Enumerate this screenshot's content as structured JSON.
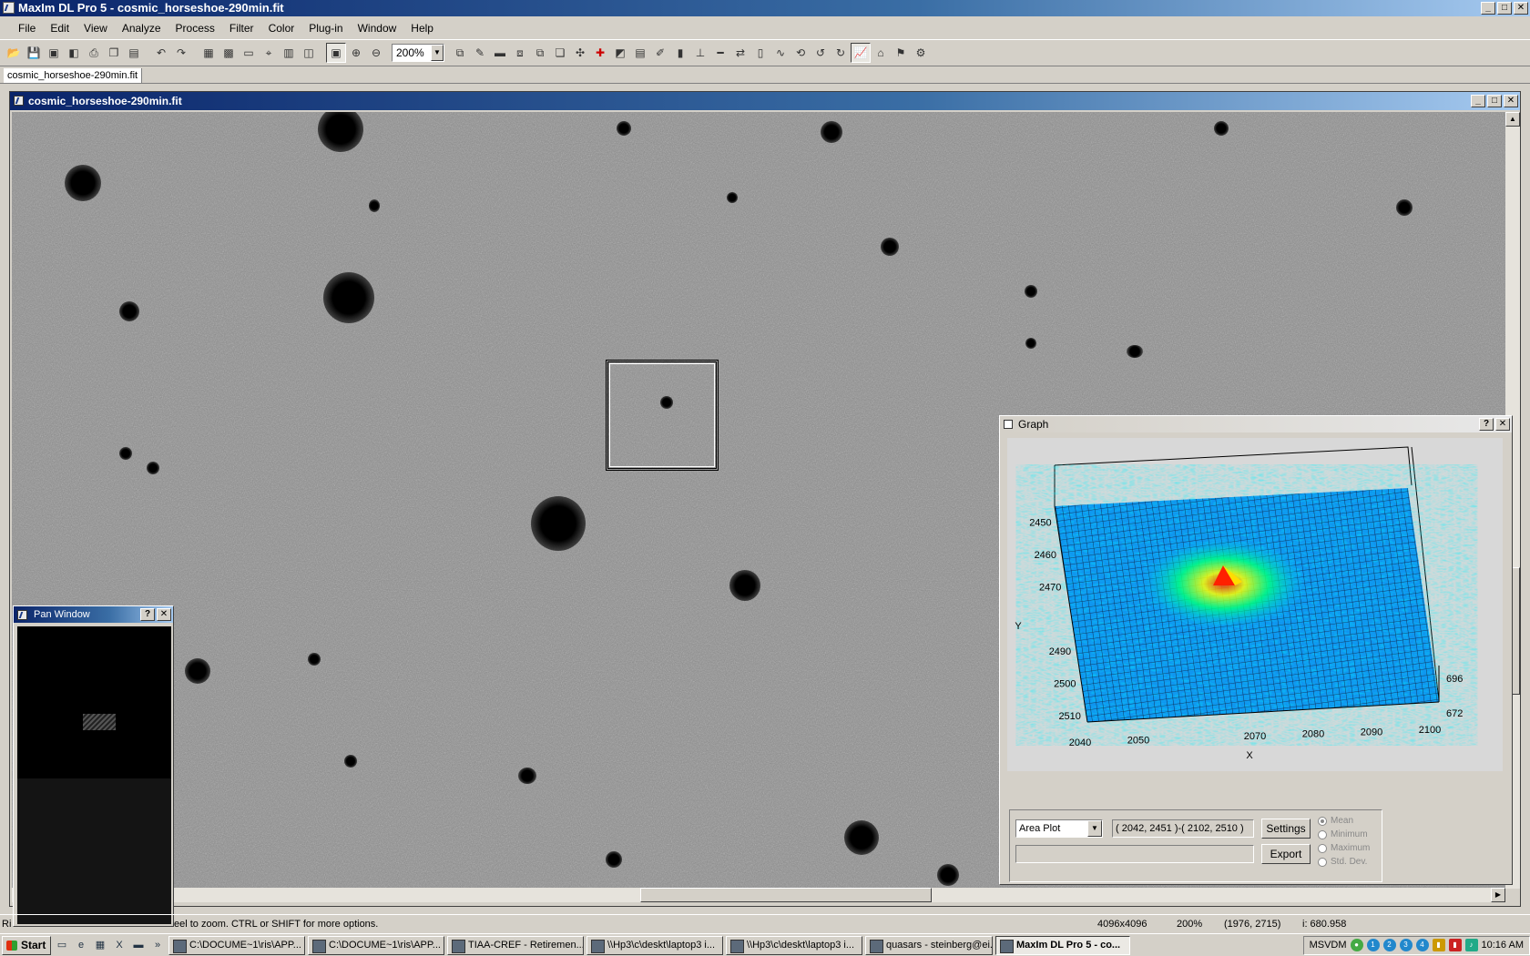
{
  "app": {
    "title": "MaxIm DL Pro 5 - cosmic_horseshoe-290min.fit",
    "window_buttons": {
      "min": "_",
      "max": "□",
      "close": "✕"
    }
  },
  "menu": [
    "File",
    "Edit",
    "View",
    "Analyze",
    "Process",
    "Filter",
    "Color",
    "Plug-in",
    "Window",
    "Help"
  ],
  "toolbar": {
    "zoom": "200%"
  },
  "doc_tab": "cosmic_horseshoe-290min.fit",
  "image_window": {
    "title": "cosmic_horseshoe-290min.fit"
  },
  "pan_window": {
    "title": "Pan Window",
    "help": "?",
    "close": "✕"
  },
  "graph": {
    "title": "Graph",
    "help": "?",
    "close": "✕",
    "plot_type": "Area Plot",
    "range": "( 2042, 2451 )-( 2102, 2510 )",
    "settings_label": "Settings",
    "export_label": "Export",
    "stat_options": [
      {
        "label": "Mean",
        "selected": true
      },
      {
        "label": "Minimum",
        "selected": false
      },
      {
        "label": "Maximum",
        "selected": false
      },
      {
        "label": "Std. Dev.",
        "selected": false
      }
    ]
  },
  "chart_data": {
    "type": "heatmap",
    "title": "",
    "xlabel": "X",
    "ylabel": "Y",
    "x_ticks": [
      2040,
      2050,
      2070,
      2080,
      2090,
      2100
    ],
    "y_ticks": [
      2450,
      2460,
      2470,
      2490,
      2500,
      2510
    ],
    "z_ticks": [
      696,
      672
    ],
    "peak": {
      "x": 2070,
      "y": 2462
    },
    "colormap": [
      "#1030c0",
      "#00c0ff",
      "#00ff80",
      "#ffff00",
      "#ff2000"
    ]
  },
  "status": {
    "hint": "Ri",
    "hint2": "eel to zoom. CTRL or SHIFT for more options.",
    "dims": "4096x4096",
    "zoom": "200%",
    "coords": "(1976, 2715)",
    "intensity": "i:  680.958"
  },
  "taskbar": {
    "start": "Start",
    "tasks": [
      {
        "label": "C:\\DOCUME~1\\ris\\APP...",
        "active": false
      },
      {
        "label": "C:\\DOCUME~1\\ris\\APP...",
        "active": false
      },
      {
        "label": "TIAA-CREF - Retiremen...",
        "active": false
      },
      {
        "label": "\\\\Hp3\\c\\deskt\\laptop3 i...",
        "active": false
      },
      {
        "label": "\\\\Hp3\\c\\deskt\\laptop3 i...",
        "active": false
      },
      {
        "label": "quasars - steinberg@ei...",
        "active": false
      },
      {
        "label": "MaxIm DL Pro 5 - co...",
        "active": true
      }
    ],
    "tray_label": "MSVDM",
    "clock": "10:16 AM"
  }
}
